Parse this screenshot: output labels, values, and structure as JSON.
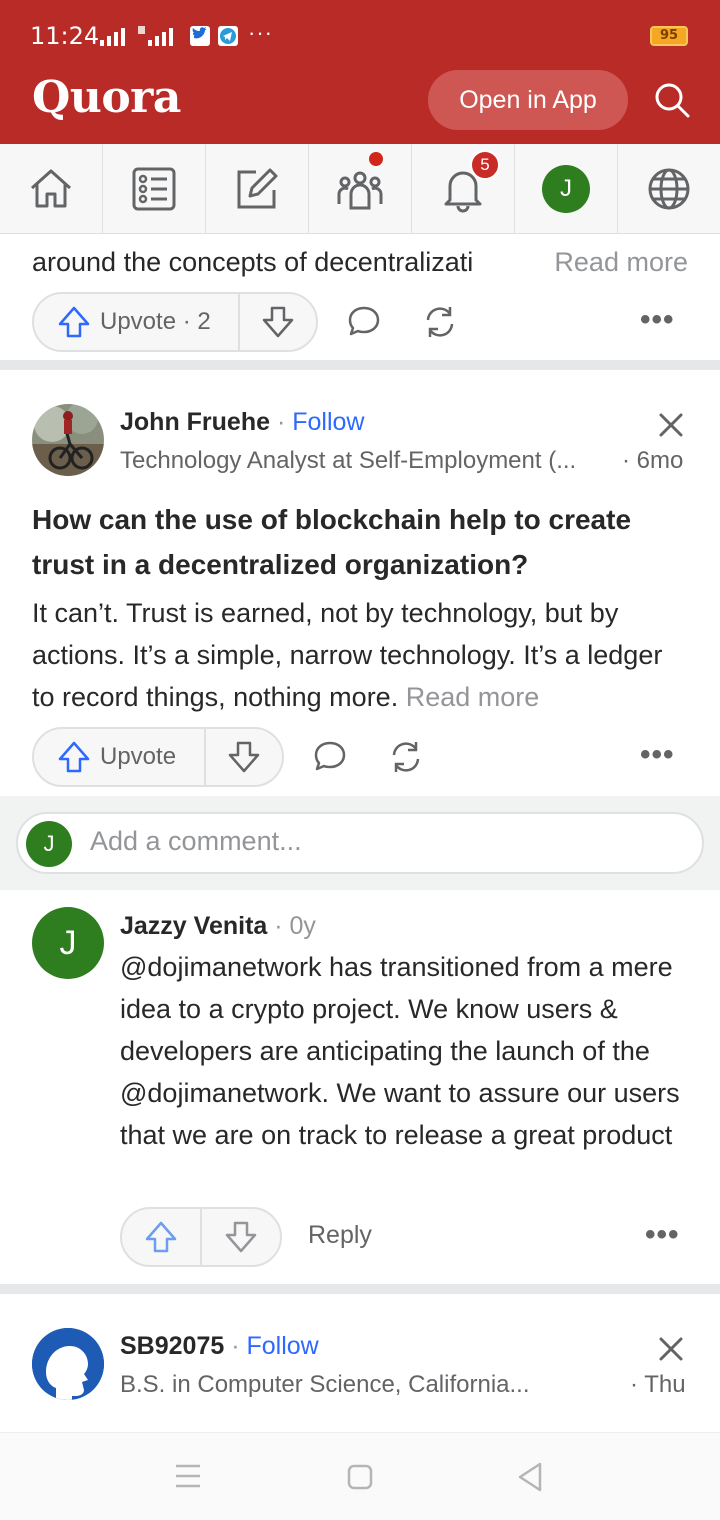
{
  "status_bar": {
    "time": "11:24",
    "battery": "95",
    "more": "···"
  },
  "header": {
    "logo": "Quora",
    "open_in_app": "Open in App"
  },
  "nav": {
    "notification_count": "5",
    "avatar_initial": "J"
  },
  "prev_answer": {
    "snippet": "around the concepts of decentralizati",
    "read_more": "Read more",
    "upvote_label": "Upvote",
    "upvote_count": "· 2"
  },
  "answer": {
    "author": "John Fruehe",
    "sep": " · ",
    "follow": "Follow",
    "credential": "Technology Analyst at Self-Employment (...",
    "time": "· 6mo",
    "question": "How can the use of blockchain help to create trust in a decentralized organization?",
    "text": "It can’t. Trust is earned, not by technology, but by actions. It’s a simple, narrow technology. It’s a ledger to record things, nothing more.",
    "read_more": "Read more",
    "upvote_label": "Upvote"
  },
  "comment_box": {
    "avatar_initial": "J",
    "placeholder": "Add a comment..."
  },
  "comment": {
    "avatar_initial": "J",
    "author": "Jazzy Venita",
    "time": " · 0y",
    "text": "@dojimanetwork has transitioned from a mere idea to a crypto project. We know users & developers are anticipating the launch of the @dojimanetwork. We want to assure our users that we are on track to release a great product",
    "reply": "Reply"
  },
  "next_answer": {
    "author": "SB92075",
    "sep": " · ",
    "follow": "Follow",
    "credential": "B.S. in Computer Science, California...",
    "time": "· Thu"
  },
  "colors": {
    "brand": "#b92b27",
    "link": "#2e69ff",
    "upvote": "#2e69ff",
    "avatar": "#2e7d1f"
  }
}
